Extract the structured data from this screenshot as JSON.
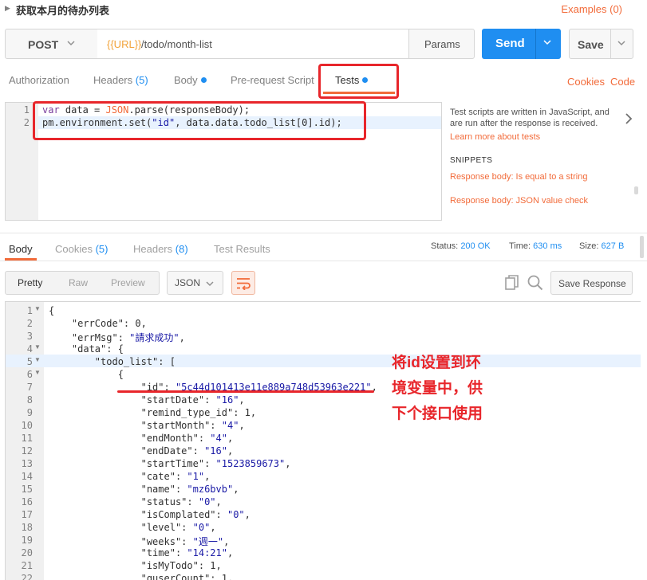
{
  "title_bar": {
    "title": "获取本月的待办列表",
    "examples": "Examples (0)"
  },
  "request": {
    "method": "POST",
    "url_var": "{{URL}}",
    "url_path": "/todo/month-list",
    "params_label": "Params",
    "send_label": "Send",
    "save_label": "Save"
  },
  "request_tabs": {
    "authorization": "Authorization",
    "headers": "Headers",
    "headers_count": "(5)",
    "body": "Body",
    "prerequest": "Pre-request Script",
    "tests": "Tests",
    "cookies": "Cookies",
    "code": "Code"
  },
  "tests_script": {
    "line_numbers": [
      "1",
      "2"
    ],
    "line1": {
      "kw": "var",
      "rest1": " data = ",
      "obj": "JSON",
      "rest2": ".parse(responseBody);"
    },
    "line2": {
      "a": "pm.environment.set(",
      "str": "\"id\"",
      "b": ", data.data.todo_list[0].id);"
    }
  },
  "snippets": {
    "description": "Test scripts are written in JavaScript, and are run after the response is received.",
    "learn_more": "Learn more about tests",
    "heading": "SNIPPETS",
    "items": [
      "Response body: Is equal to a string",
      "Response body: JSON value check"
    ]
  },
  "response_tabs": {
    "body": "Body",
    "cookies": "Cookies",
    "cookies_count": "(5)",
    "headers": "Headers",
    "headers_count": "(8)",
    "test_results": "Test Results"
  },
  "response_status": {
    "status_label": "Status:",
    "status_value": "200 OK",
    "time_label": "Time:",
    "time_value": "630 ms",
    "size_label": "Size:",
    "size_value": "627 B"
  },
  "body_toolbar": {
    "pretty": "Pretty",
    "raw": "Raw",
    "preview": "Preview",
    "format": "JSON",
    "save_response": "Save Response"
  },
  "response_lines": [
    {
      "n": "1",
      "fold": true,
      "text": "{"
    },
    {
      "n": "2",
      "fold": false,
      "text": "    \"errCode\": 0,"
    },
    {
      "n": "3",
      "fold": false,
      "text": "    \"errMsg\": \"請求成功\","
    },
    {
      "n": "4",
      "fold": true,
      "text": "    \"data\": {"
    },
    {
      "n": "5",
      "fold": true,
      "text": "        \"todo_list\": ["
    },
    {
      "n": "6",
      "fold": true,
      "text": "            {"
    },
    {
      "n": "7",
      "fold": false,
      "text": "                \"id\": \"5c44d101413e11e889a748d53963e221\","
    },
    {
      "n": "8",
      "fold": false,
      "text": "                \"startDate\": \"16\","
    },
    {
      "n": "9",
      "fold": false,
      "text": "                \"remind_type_id\": 1,"
    },
    {
      "n": "10",
      "fold": false,
      "text": "                \"startMonth\": \"4\","
    },
    {
      "n": "11",
      "fold": false,
      "text": "                \"endMonth\": \"4\","
    },
    {
      "n": "12",
      "fold": false,
      "text": "                \"endDate\": \"16\","
    },
    {
      "n": "13",
      "fold": false,
      "text": "                \"startTime\": \"1523859673\","
    },
    {
      "n": "14",
      "fold": false,
      "text": "                \"cate\": \"1\","
    },
    {
      "n": "15",
      "fold": false,
      "text": "                \"name\": \"mz6bvb\","
    },
    {
      "n": "16",
      "fold": false,
      "text": "                \"status\": \"0\","
    },
    {
      "n": "17",
      "fold": false,
      "text": "                \"isComplated\": \"0\","
    },
    {
      "n": "18",
      "fold": false,
      "text": "                \"level\": \"0\","
    },
    {
      "n": "19",
      "fold": false,
      "text": "                \"weeks\": \"週一\","
    },
    {
      "n": "20",
      "fold": false,
      "text": "                \"time\": \"14:21\","
    },
    {
      "n": "21",
      "fold": false,
      "text": "                \"isMyTodo\": 1,"
    },
    {
      "n": "22",
      "fold": false,
      "text": "                \"guserCount\": 1,"
    }
  ],
  "annotation": {
    "line1": "将id设置到环",
    "line2": "境变量中，供",
    "line3": "下个接口使用"
  },
  "colors": {
    "accent_orange": "#f26b3a",
    "send_blue": "#1f8ef1",
    "annotation_red": "#e8262b"
  }
}
